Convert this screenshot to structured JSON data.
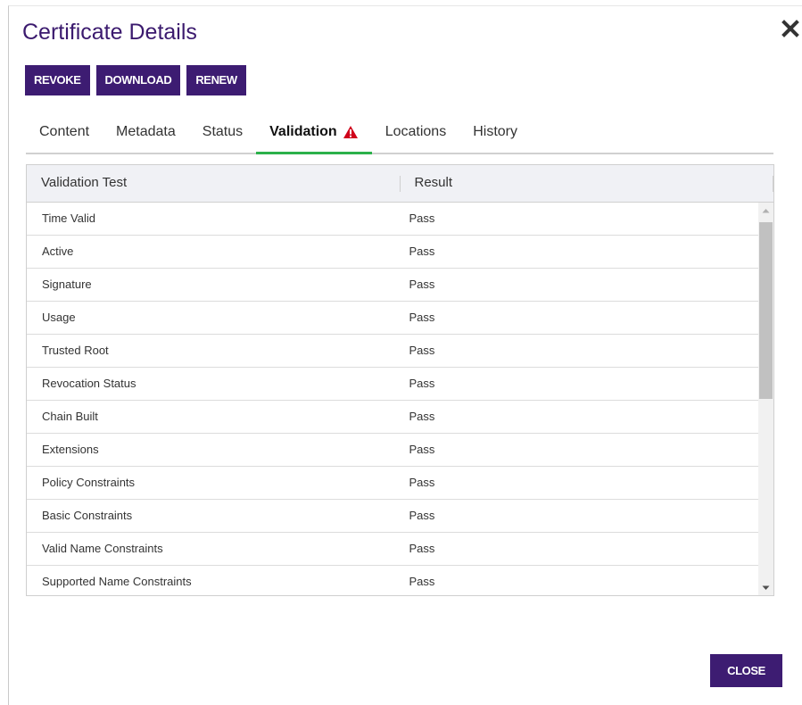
{
  "dialog": {
    "title": "Certificate Details",
    "close_icon": "close-icon"
  },
  "actions": {
    "revoke": "REVOKE",
    "download": "DOWNLOAD",
    "renew": "RENEW"
  },
  "tabs": [
    {
      "label": "Content"
    },
    {
      "label": "Metadata"
    },
    {
      "label": "Status"
    },
    {
      "label": "Validation",
      "active": true,
      "icon": "warning-icon"
    },
    {
      "label": "Locations"
    },
    {
      "label": "History"
    }
  ],
  "grid": {
    "columns": [
      "Validation Test",
      "Result"
    ],
    "rows": [
      [
        "Time Valid",
        "Pass"
      ],
      [
        "Active",
        "Pass"
      ],
      [
        "Signature",
        "Pass"
      ],
      [
        "Usage",
        "Pass"
      ],
      [
        "Trusted Root",
        "Pass"
      ],
      [
        "Revocation Status",
        "Pass"
      ],
      [
        "Chain Built",
        "Pass"
      ],
      [
        "Extensions",
        "Pass"
      ],
      [
        "Policy Constraints",
        "Pass"
      ],
      [
        "Basic Constraints",
        "Pass"
      ],
      [
        "Valid Name Constraints",
        "Pass"
      ],
      [
        "Supported Name Constraints",
        "Pass"
      ]
    ]
  },
  "footer": {
    "close_label": "CLOSE"
  },
  "colors": {
    "title": "#3b1a6e",
    "button": "#3d1c72",
    "active_tab_underline": "#2bb14a",
    "warning": "#d0021b"
  }
}
